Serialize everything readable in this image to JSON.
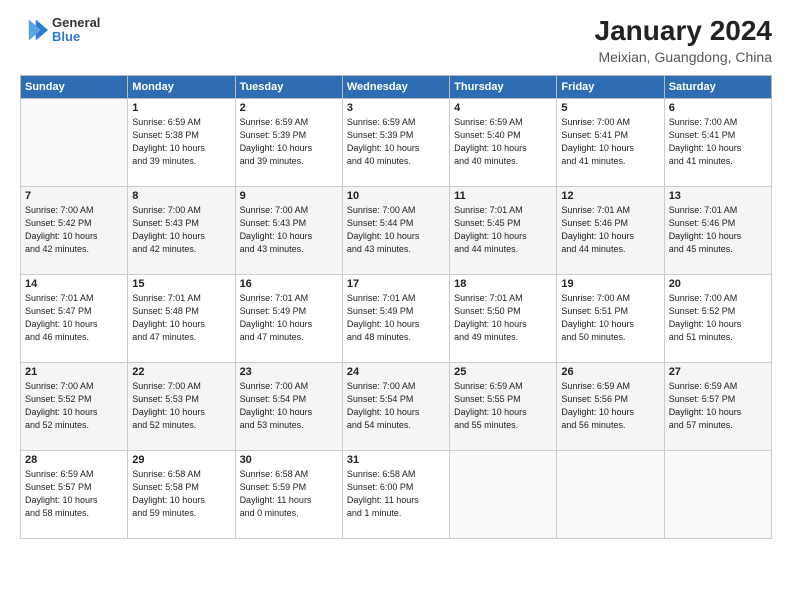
{
  "header": {
    "logo_line1": "General",
    "logo_line2": "Blue",
    "title": "January 2024",
    "subtitle": "Meixian, Guangdong, China"
  },
  "columns": [
    "Sunday",
    "Monday",
    "Tuesday",
    "Wednesday",
    "Thursday",
    "Friday",
    "Saturday"
  ],
  "weeks": [
    [
      {
        "day": "",
        "info": ""
      },
      {
        "day": "1",
        "info": "Sunrise: 6:59 AM\nSunset: 5:38 PM\nDaylight: 10 hours\nand 39 minutes."
      },
      {
        "day": "2",
        "info": "Sunrise: 6:59 AM\nSunset: 5:39 PM\nDaylight: 10 hours\nand 39 minutes."
      },
      {
        "day": "3",
        "info": "Sunrise: 6:59 AM\nSunset: 5:39 PM\nDaylight: 10 hours\nand 40 minutes."
      },
      {
        "day": "4",
        "info": "Sunrise: 6:59 AM\nSunset: 5:40 PM\nDaylight: 10 hours\nand 40 minutes."
      },
      {
        "day": "5",
        "info": "Sunrise: 7:00 AM\nSunset: 5:41 PM\nDaylight: 10 hours\nand 41 minutes."
      },
      {
        "day": "6",
        "info": "Sunrise: 7:00 AM\nSunset: 5:41 PM\nDaylight: 10 hours\nand 41 minutes."
      }
    ],
    [
      {
        "day": "7",
        "info": "Sunrise: 7:00 AM\nSunset: 5:42 PM\nDaylight: 10 hours\nand 42 minutes."
      },
      {
        "day": "8",
        "info": "Sunrise: 7:00 AM\nSunset: 5:43 PM\nDaylight: 10 hours\nand 42 minutes."
      },
      {
        "day": "9",
        "info": "Sunrise: 7:00 AM\nSunset: 5:43 PM\nDaylight: 10 hours\nand 43 minutes."
      },
      {
        "day": "10",
        "info": "Sunrise: 7:00 AM\nSunset: 5:44 PM\nDaylight: 10 hours\nand 43 minutes."
      },
      {
        "day": "11",
        "info": "Sunrise: 7:01 AM\nSunset: 5:45 PM\nDaylight: 10 hours\nand 44 minutes."
      },
      {
        "day": "12",
        "info": "Sunrise: 7:01 AM\nSunset: 5:46 PM\nDaylight: 10 hours\nand 44 minutes."
      },
      {
        "day": "13",
        "info": "Sunrise: 7:01 AM\nSunset: 5:46 PM\nDaylight: 10 hours\nand 45 minutes."
      }
    ],
    [
      {
        "day": "14",
        "info": "Sunrise: 7:01 AM\nSunset: 5:47 PM\nDaylight: 10 hours\nand 46 minutes."
      },
      {
        "day": "15",
        "info": "Sunrise: 7:01 AM\nSunset: 5:48 PM\nDaylight: 10 hours\nand 47 minutes."
      },
      {
        "day": "16",
        "info": "Sunrise: 7:01 AM\nSunset: 5:49 PM\nDaylight: 10 hours\nand 47 minutes."
      },
      {
        "day": "17",
        "info": "Sunrise: 7:01 AM\nSunset: 5:49 PM\nDaylight: 10 hours\nand 48 minutes."
      },
      {
        "day": "18",
        "info": "Sunrise: 7:01 AM\nSunset: 5:50 PM\nDaylight: 10 hours\nand 49 minutes."
      },
      {
        "day": "19",
        "info": "Sunrise: 7:00 AM\nSunset: 5:51 PM\nDaylight: 10 hours\nand 50 minutes."
      },
      {
        "day": "20",
        "info": "Sunrise: 7:00 AM\nSunset: 5:52 PM\nDaylight: 10 hours\nand 51 minutes."
      }
    ],
    [
      {
        "day": "21",
        "info": "Sunrise: 7:00 AM\nSunset: 5:52 PM\nDaylight: 10 hours\nand 52 minutes."
      },
      {
        "day": "22",
        "info": "Sunrise: 7:00 AM\nSunset: 5:53 PM\nDaylight: 10 hours\nand 52 minutes."
      },
      {
        "day": "23",
        "info": "Sunrise: 7:00 AM\nSunset: 5:54 PM\nDaylight: 10 hours\nand 53 minutes."
      },
      {
        "day": "24",
        "info": "Sunrise: 7:00 AM\nSunset: 5:54 PM\nDaylight: 10 hours\nand 54 minutes."
      },
      {
        "day": "25",
        "info": "Sunrise: 6:59 AM\nSunset: 5:55 PM\nDaylight: 10 hours\nand 55 minutes."
      },
      {
        "day": "26",
        "info": "Sunrise: 6:59 AM\nSunset: 5:56 PM\nDaylight: 10 hours\nand 56 minutes."
      },
      {
        "day": "27",
        "info": "Sunrise: 6:59 AM\nSunset: 5:57 PM\nDaylight: 10 hours\nand 57 minutes."
      }
    ],
    [
      {
        "day": "28",
        "info": "Sunrise: 6:59 AM\nSunset: 5:57 PM\nDaylight: 10 hours\nand 58 minutes."
      },
      {
        "day": "29",
        "info": "Sunrise: 6:58 AM\nSunset: 5:58 PM\nDaylight: 10 hours\nand 59 minutes."
      },
      {
        "day": "30",
        "info": "Sunrise: 6:58 AM\nSunset: 5:59 PM\nDaylight: 11 hours\nand 0 minutes."
      },
      {
        "day": "31",
        "info": "Sunrise: 6:58 AM\nSunset: 6:00 PM\nDaylight: 11 hours\nand 1 minute."
      },
      {
        "day": "",
        "info": ""
      },
      {
        "day": "",
        "info": ""
      },
      {
        "day": "",
        "info": ""
      }
    ]
  ]
}
